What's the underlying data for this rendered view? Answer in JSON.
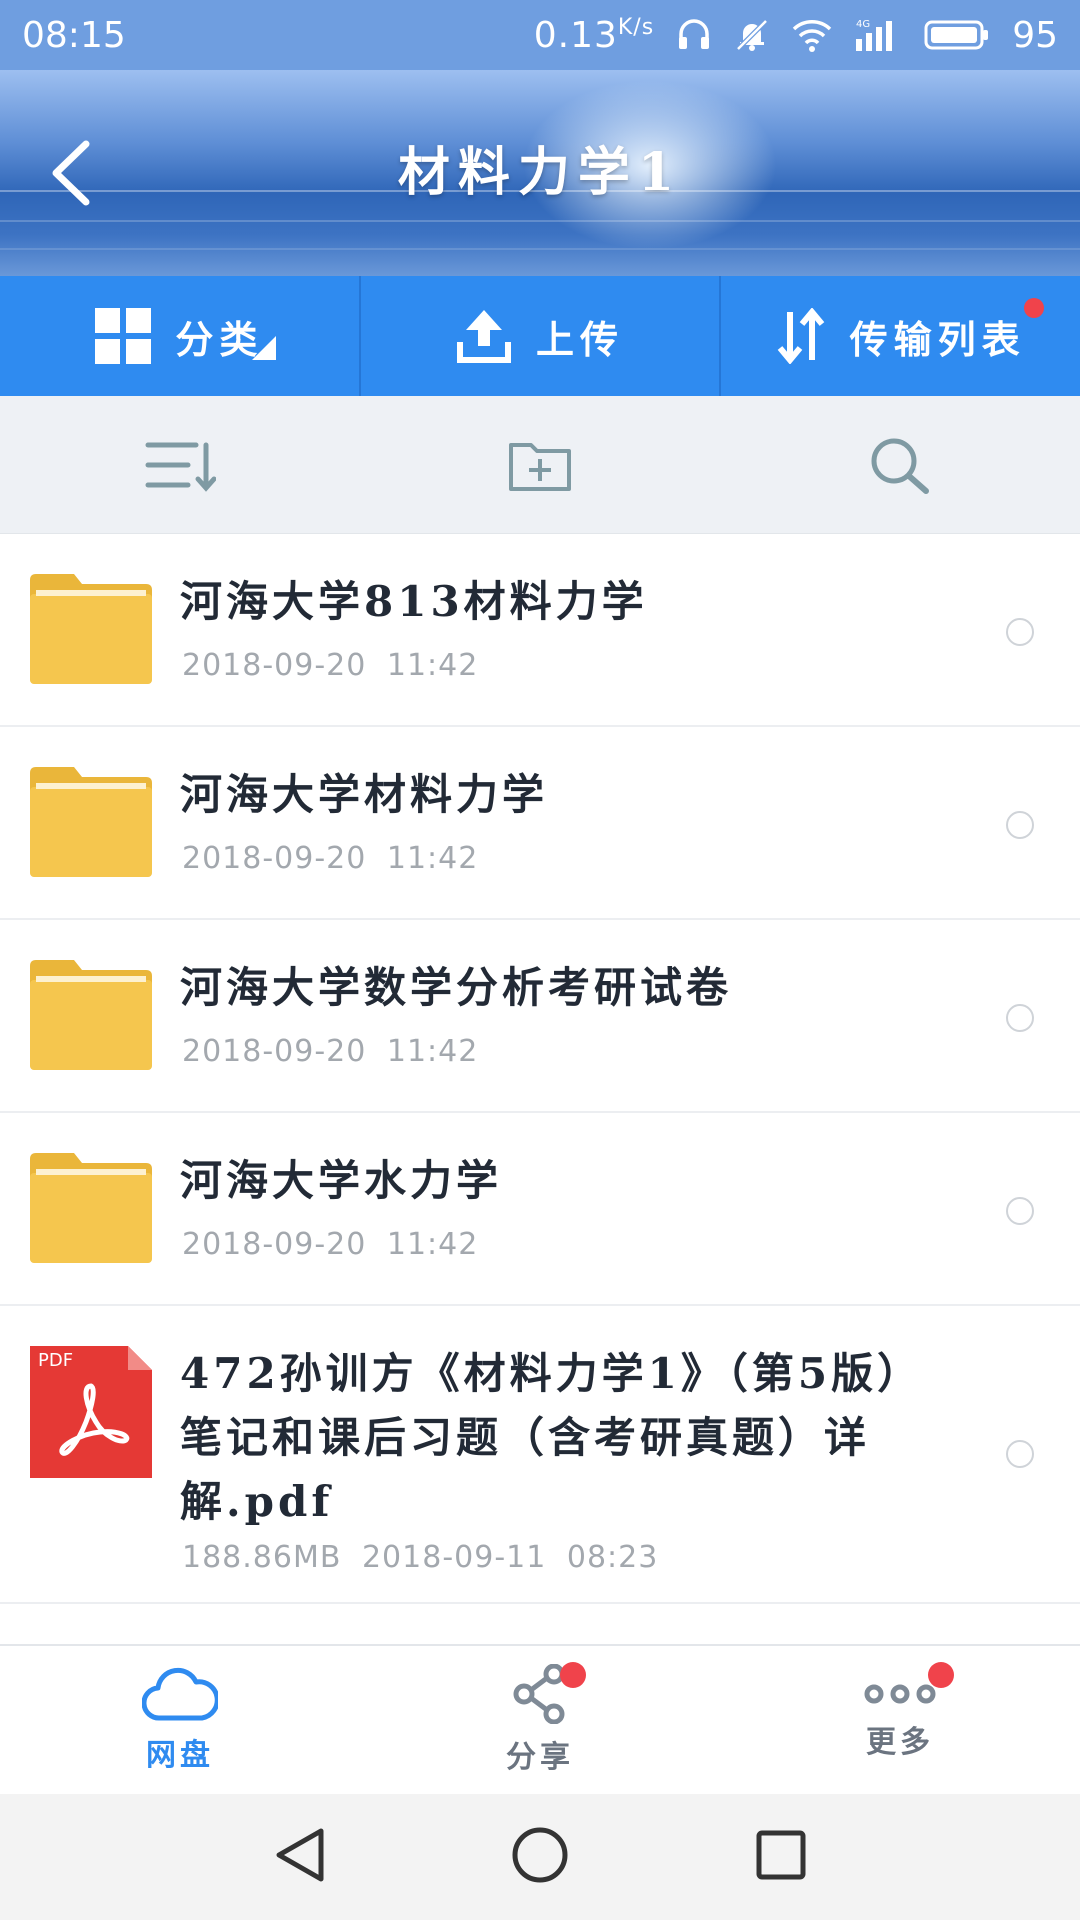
{
  "status_bar": {
    "time": "08:15",
    "speed": "0.13",
    "speed_unit": "K/s",
    "battery": "95",
    "network": "4G"
  },
  "header": {
    "title": "材料力学1"
  },
  "actions": {
    "category_label": "分类",
    "upload_label": "上传",
    "transfer_label": "传输列表"
  },
  "files": [
    {
      "name": "河海大学813材料力学",
      "meta": "2018-09-20  11:42",
      "type": "folder"
    },
    {
      "name": "河海大学材料力学",
      "meta": "2018-09-20  11:42",
      "type": "folder"
    },
    {
      "name": "河海大学数学分析考研试卷",
      "meta": "2018-09-20  11:42",
      "type": "folder"
    },
    {
      "name": "河海大学水力学",
      "meta": "2018-09-20  11:42",
      "type": "folder"
    },
    {
      "name": "472孙训方《材料力学1》（第5版）笔记和课后习题（含考研真题）详解.pdf",
      "meta": "188.86MB  2018-09-11  08:23",
      "type": "pdf",
      "badge": "PDF"
    }
  ],
  "tabs": {
    "disk_label": "网盘",
    "share_label": "分享",
    "more_label": "更多"
  },
  "colors": {
    "accent": "#2f8bf0",
    "status_bar": "#6f9ee0",
    "folder": "#f5c64e",
    "pdf": "#e53935",
    "badge": "#f0434b"
  }
}
